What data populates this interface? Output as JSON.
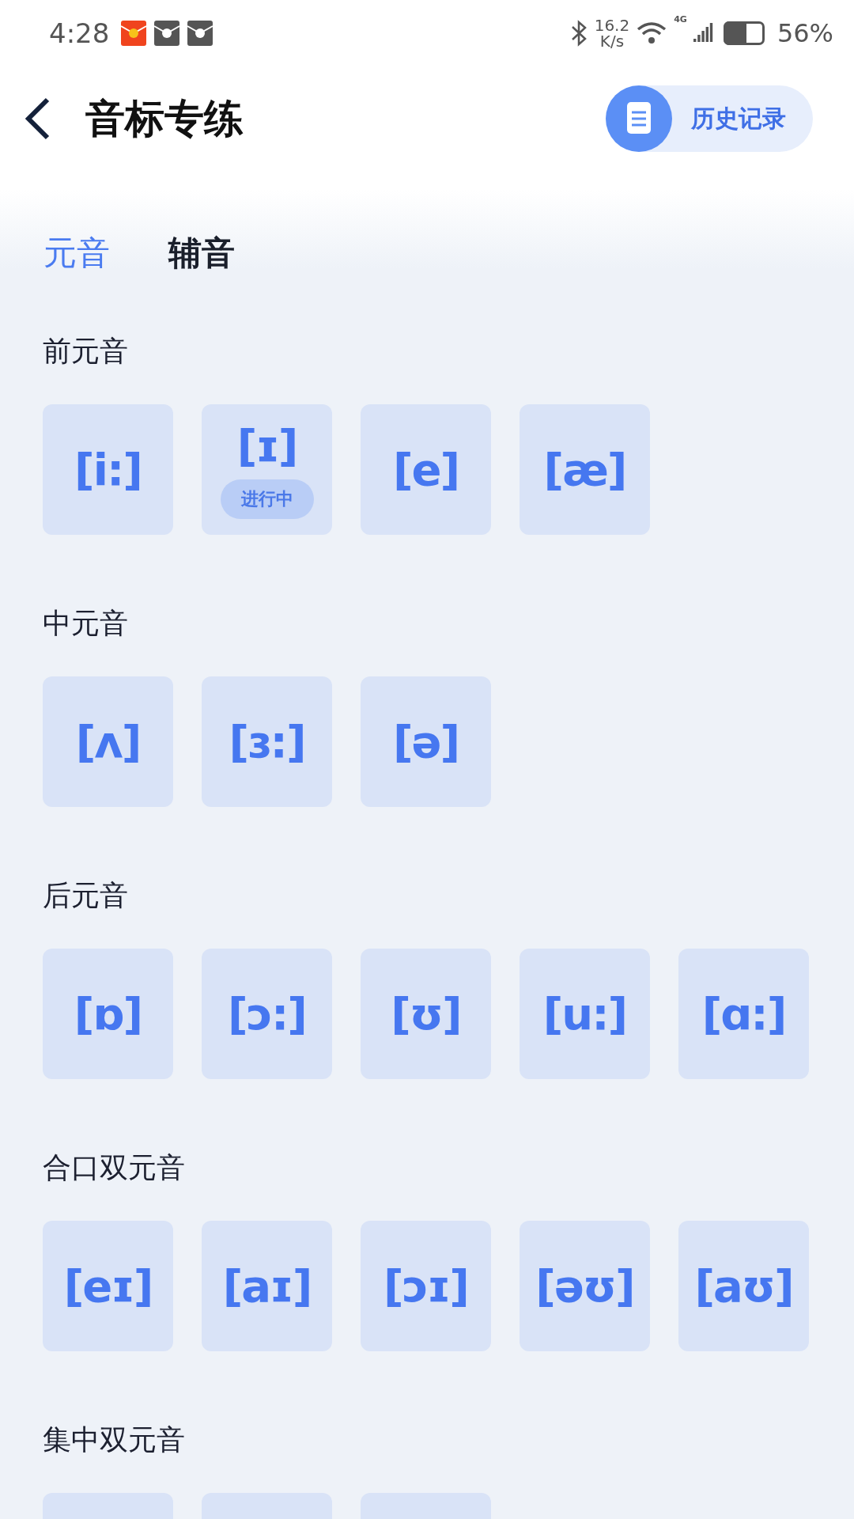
{
  "status_bar": {
    "time": "4:28",
    "notifications": [
      {
        "kind": "red"
      },
      {
        "kind": "grey"
      },
      {
        "kind": "grey"
      }
    ],
    "net_speed": "16.2",
    "net_unit": "K/s",
    "network": "4G",
    "battery": {
      "level": 0.56,
      "text": "56%"
    }
  },
  "header": {
    "title": "音标专练",
    "history_button": "历史记录"
  },
  "tabs": [
    {
      "label": "元音",
      "selected": true
    },
    {
      "label": "辅音",
      "selected": false
    }
  ],
  "sections": [
    {
      "title": "前元音",
      "tiles": [
        {
          "kind": "phoneme",
          "symbol": "[i:]",
          "in_progress": false
        },
        {
          "kind": "phoneme",
          "symbol": "[ɪ]",
          "in_progress": true,
          "badge": "进行中"
        },
        {
          "kind": "phoneme",
          "symbol": "[e]",
          "in_progress": false
        },
        {
          "kind": "phoneme",
          "symbol": "[æ]",
          "in_progress": false
        }
      ]
    },
    {
      "title": "中元音",
      "tiles": [
        {
          "kind": "phoneme",
          "symbol": "[ʌ]",
          "in_progress": false
        },
        {
          "kind": "phoneme",
          "symbol": "[ɜ:]",
          "in_progress": false
        },
        {
          "kind": "phoneme",
          "symbol": "[ə]",
          "in_progress": false
        }
      ]
    },
    {
      "title": "后元音",
      "tiles": [
        {
          "kind": "phoneme",
          "symbol": "[ɒ]",
          "in_progress": false
        },
        {
          "kind": "phoneme",
          "symbol": "[ɔ:]",
          "in_progress": false
        },
        {
          "kind": "phoneme",
          "symbol": "[ʊ]",
          "in_progress": false
        },
        {
          "kind": "phoneme",
          "symbol": "[u:]",
          "in_progress": false
        },
        {
          "kind": "phoneme",
          "symbol": "[ɑ:]",
          "in_progress": false
        }
      ]
    },
    {
      "title": "合口双元音",
      "tiles": [
        {
          "kind": "phoneme",
          "symbol": "[eɪ]",
          "in_progress": false
        },
        {
          "kind": "phoneme",
          "symbol": "[aɪ]",
          "in_progress": false
        },
        {
          "kind": "phoneme",
          "symbol": "[ɔɪ]",
          "in_progress": false
        },
        {
          "kind": "phoneme",
          "symbol": "[əʊ]",
          "in_progress": false
        },
        {
          "kind": "phoneme",
          "symbol": "[aʊ]",
          "in_progress": false
        }
      ]
    },
    {
      "title": "集中双元音",
      "tiles": [
        {
          "kind": "cut-off"
        },
        {
          "kind": "cut-off"
        },
        {
          "kind": "cut-off"
        }
      ]
    }
  ]
}
